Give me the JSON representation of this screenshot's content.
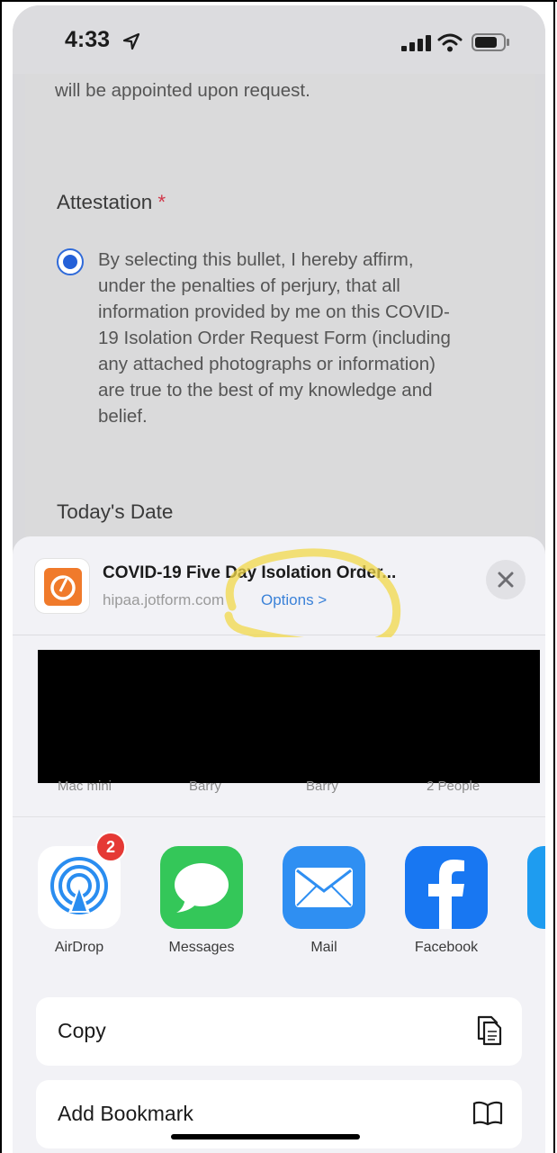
{
  "status_bar": {
    "time": "4:33"
  },
  "form": {
    "intro_text": "will be appointed upon request.",
    "attestation_label": "Attestation",
    "required_marker": "*",
    "attestation_text_lines": [
      "By selecting this bullet, I hereby affirm,",
      "under the penalties of perjury, that all",
      "information provided by me on this COVID-",
      "19 Isolation Order Request Form (including",
      "any attached photographs or information)",
      "are true to the best of my knowledge and",
      "belief."
    ],
    "date_label": "Today's Date"
  },
  "share_sheet": {
    "title": "COVID-19 Five Day Isolation Order...",
    "domain": "hipaa.jotform.com",
    "options_label": "Options >",
    "people": [
      "Mac mini",
      "Barry",
      "Barry",
      "2 People"
    ],
    "apps": [
      {
        "name": "AirDrop",
        "badge": "2"
      },
      {
        "name": "Messages"
      },
      {
        "name": "Mail"
      },
      {
        "name": "Facebook"
      }
    ],
    "actions": [
      {
        "label": "Copy",
        "icon": "copy-icon"
      },
      {
        "label": "Add Bookmark",
        "icon": "book-icon"
      }
    ]
  },
  "colors": {
    "accent_blue": "#3b82d8",
    "required_red": "#d1374a",
    "highlight_yellow": "#f2d84a"
  }
}
